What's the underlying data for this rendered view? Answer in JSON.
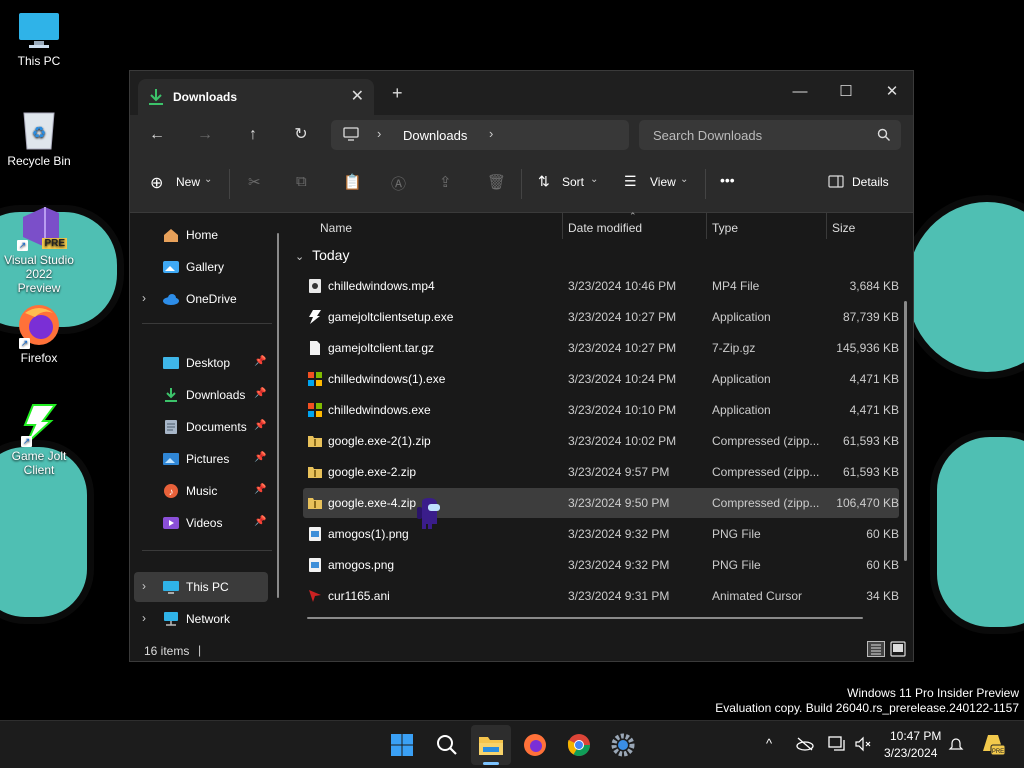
{
  "desktop": {
    "icons": [
      {
        "label": "This PC"
      },
      {
        "label": "Recycle Bin"
      },
      {
        "label": "Visual Studio 2022 Preview",
        "badge": "PRE"
      },
      {
        "label": "Firefox"
      },
      {
        "label": "Game Jolt Client"
      }
    ],
    "watermark": {
      "line1": "Windows 11 Pro Insider Preview",
      "line2": "Evaluation copy. Build 26040.rs_prerelease.240122-1157"
    },
    "colors": {
      "wallpaper_accent": "#4fbfb3",
      "wallpaper_bg": "#000000"
    }
  },
  "window": {
    "tab_title": "Downloads",
    "tab_close": "✕",
    "new_tab": "+",
    "controls": {
      "minimize": "—",
      "maximize": "☐",
      "close": "✕"
    },
    "address": {
      "crumb": "Downloads"
    },
    "search": {
      "placeholder": "Search Downloads"
    },
    "toolbar": {
      "new_label": "New",
      "sort_label": "Sort",
      "view_label": "View",
      "more_label": "•••",
      "details_label": "Details"
    },
    "nav": {
      "items": [
        {
          "label": "Home"
        },
        {
          "label": "Gallery"
        },
        {
          "label": "OneDrive"
        },
        {
          "label": "Desktop"
        },
        {
          "label": "Downloads"
        },
        {
          "label": "Documents"
        },
        {
          "label": "Pictures"
        },
        {
          "label": "Music"
        },
        {
          "label": "Videos"
        },
        {
          "label": "This PC"
        },
        {
          "label": "Network"
        }
      ]
    },
    "columns": {
      "name": "Name",
      "date": "Date modified",
      "type": "Type",
      "size": "Size"
    },
    "group": "Today",
    "files": [
      {
        "name": "chilledwindows.mp4",
        "date": "3/23/2024 10:46 PM",
        "type": "MP4 File",
        "size": "3,684 KB"
      },
      {
        "name": "gamejoltclientsetup.exe",
        "date": "3/23/2024 10:27 PM",
        "type": "Application",
        "size": "87,739 KB"
      },
      {
        "name": "gamejoltclient.tar.gz",
        "date": "3/23/2024 10:27 PM",
        "type": "7-Zip.gz",
        "size": "145,936 KB"
      },
      {
        "name": "chilledwindows(1).exe",
        "date": "3/23/2024 10:24 PM",
        "type": "Application",
        "size": "4,471 KB"
      },
      {
        "name": "chilledwindows.exe",
        "date": "3/23/2024 10:10 PM",
        "type": "Application",
        "size": "4,471 KB"
      },
      {
        "name": "google.exe-2(1).zip",
        "date": "3/23/2024 10:02 PM",
        "type": "Compressed (zipp...",
        "size": "61,593 KB"
      },
      {
        "name": "google.exe-2.zip",
        "date": "3/23/2024 9:57 PM",
        "type": "Compressed (zipp...",
        "size": "61,593 KB"
      },
      {
        "name": "google.exe-4.zip",
        "date": "3/23/2024 9:50 PM",
        "type": "Compressed (zipp...",
        "size": "106,470 KB"
      },
      {
        "name": "amogos(1).png",
        "date": "3/23/2024 9:32 PM",
        "type": "PNG File",
        "size": "60 KB"
      },
      {
        "name": "amogos.png",
        "date": "3/23/2024 9:32 PM",
        "type": "PNG File",
        "size": "60 KB"
      },
      {
        "name": "cur1165.ani",
        "date": "3/23/2024 9:31 PM",
        "type": "Animated Cursor",
        "size": "34 KB"
      }
    ],
    "status": {
      "count": "16 items"
    }
  },
  "taskbar": {
    "time": "10:47 PM",
    "date": "3/23/2024",
    "tray_chevron": "^"
  }
}
